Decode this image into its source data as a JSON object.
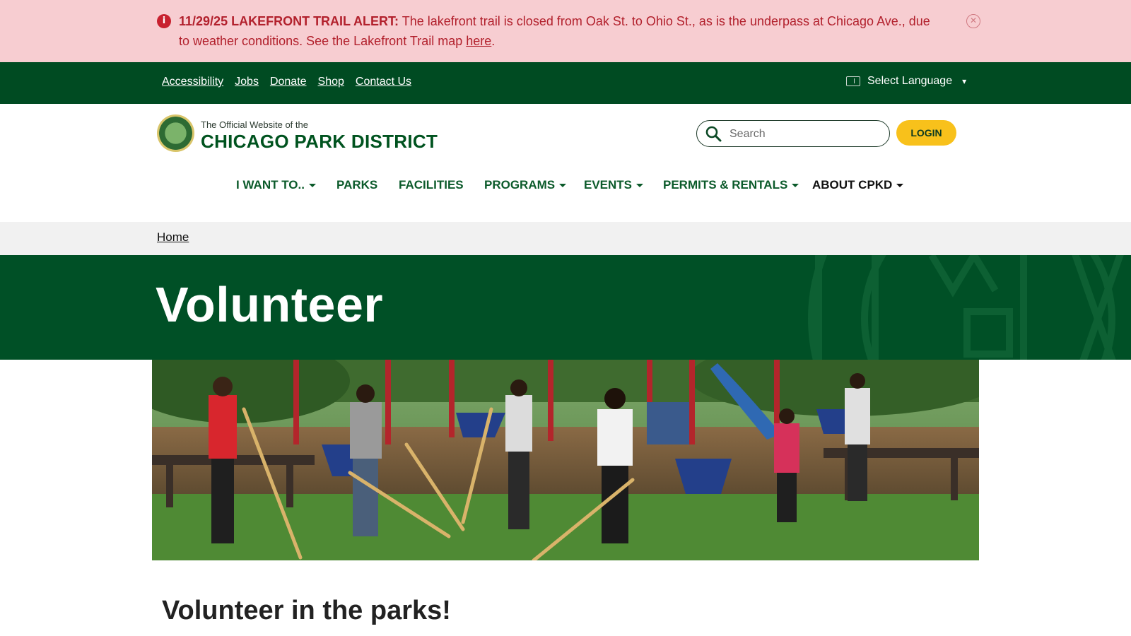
{
  "alert": {
    "icon": "info-icon",
    "date_title": "11/29/25 LAKEFRONT TRAIL ALERT:",
    "message": "The lakefront trail is closed from Oak St. to Ohio St., as is the underpass at Chicago Ave., due to weather conditions. See the Lakefront Trail map",
    "link_text": "here",
    "link_suffix": ".",
    "close_icon": "close-icon"
  },
  "utility_bar": {
    "links": [
      "Accessibility",
      "Jobs",
      "Donate",
      "Shop",
      "Contact Us"
    ],
    "language_label": "Select Language",
    "language_caret": "▾"
  },
  "header": {
    "logo_small": "The Official Website of the",
    "logo_big": "CHICAGO PARK DISTRICT",
    "search_placeholder": "Search",
    "login_label": "LOGIN"
  },
  "nav": {
    "items": [
      {
        "label": "I WANT TO..",
        "dropdown": true
      },
      {
        "label": "PARKS",
        "dropdown": false
      },
      {
        "label": "FACILITIES",
        "dropdown": false
      },
      {
        "label": "PROGRAMS",
        "dropdown": true
      },
      {
        "label": "EVENTS",
        "dropdown": true
      },
      {
        "label": "PERMITS & RENTALS",
        "dropdown": true
      },
      {
        "label": "ABOUT CPKD",
        "dropdown": true
      }
    ]
  },
  "breadcrumb": {
    "home": "Home"
  },
  "hero": {
    "title": "Volunteer"
  },
  "content": {
    "section_title": "Volunteer in the parks!"
  },
  "colors": {
    "alert_bg": "#f7cdd1",
    "alert_text": "#b2202c",
    "brand_green": "#004b22",
    "hero_green": "#005026",
    "login_yellow": "#f8c11b",
    "nav_green": "#0b5a2a"
  }
}
